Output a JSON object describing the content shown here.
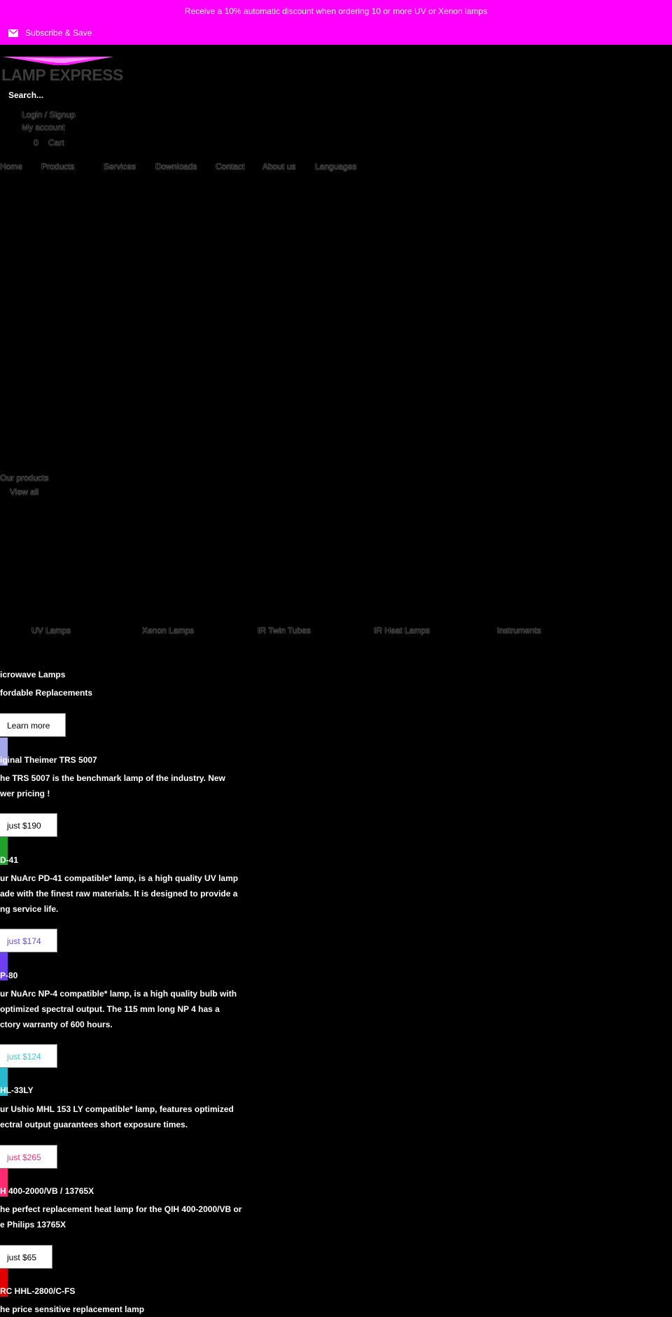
{
  "announcement": {
    "text": "Receive a 10% automatic discount when ordering 10 or more UV or Xenon lamps",
    "subscribe_label": "Subscribe & Save"
  },
  "brand": {
    "logo_text": "LAMP EXPRESS"
  },
  "search": {
    "placeholder": "Search..."
  },
  "account": {
    "login": "Login / Signup",
    "my_account": "My account",
    "cart_count": "0",
    "cart_label": "Cart"
  },
  "nav": [
    "Home",
    "Products",
    "Services",
    "Downloads",
    "Contact",
    "About us",
    "Languages"
  ],
  "products_header": {
    "title": "Our products",
    "view_all": "View all"
  },
  "categories": [
    "UV Lamps",
    "Xenon Lamps",
    "IR Twin Tubes",
    "IR Heat Lamps",
    "Instruments"
  ],
  "feature": {
    "title": "icrowave Lamps",
    "subtitle": "fordable Replacements",
    "button": "Learn more"
  },
  "products": [
    {
      "name": "iginal Theimer TRS 5007",
      "desc": [
        "he TRS 5007 is the benchmark lamp of the industry. New",
        "wer pricing !"
      ],
      "price": "just $190",
      "color": "#a4a8e8"
    },
    {
      "name": "D-41",
      "desc": [
        "ur NuArc PD-41 compatible* lamp, is a high quality UV lamp",
        "ade with the finest raw materials. It is designed to provide a",
        "ng service life."
      ],
      "price": "just $174",
      "color": "#22a02e"
    },
    {
      "name": "P-80",
      "desc": [
        "ur NuArc NP-4 compatible* lamp, is a high quality bulb with",
        "optimized spectral output. The 115 mm long NP 4 has a",
        "ctory warranty of 600 hours."
      ],
      "price": "just $124",
      "color": "#6e3ff0"
    },
    {
      "name": "HL-33LY",
      "desc": [
        "ur Ushio MHL 153 LY compatible* lamp, features optimized",
        "ectral output guarantees short exposure times."
      ],
      "price": "just $265",
      "color": "#29b9cf"
    },
    {
      "name": "H 400-2000/VB / 13765X",
      "desc": [
        "he perfect replacement heat lamp for the QIH 400-2000/VB or",
        "e Philips 13765X"
      ],
      "price": "just $65",
      "color": "#ff2a70"
    },
    {
      "name": "RC HHL-2800/C-FS",
      "desc": [
        "he price sensitive replacement lamp"
      ],
      "price": "",
      "color": "#e00000"
    }
  ],
  "colors": {
    "topbar": "#ff00ff",
    "price_colors": [
      "#000000",
      "#6b4bd8",
      "#45c4cf",
      "#e8357e",
      "#000000"
    ]
  }
}
